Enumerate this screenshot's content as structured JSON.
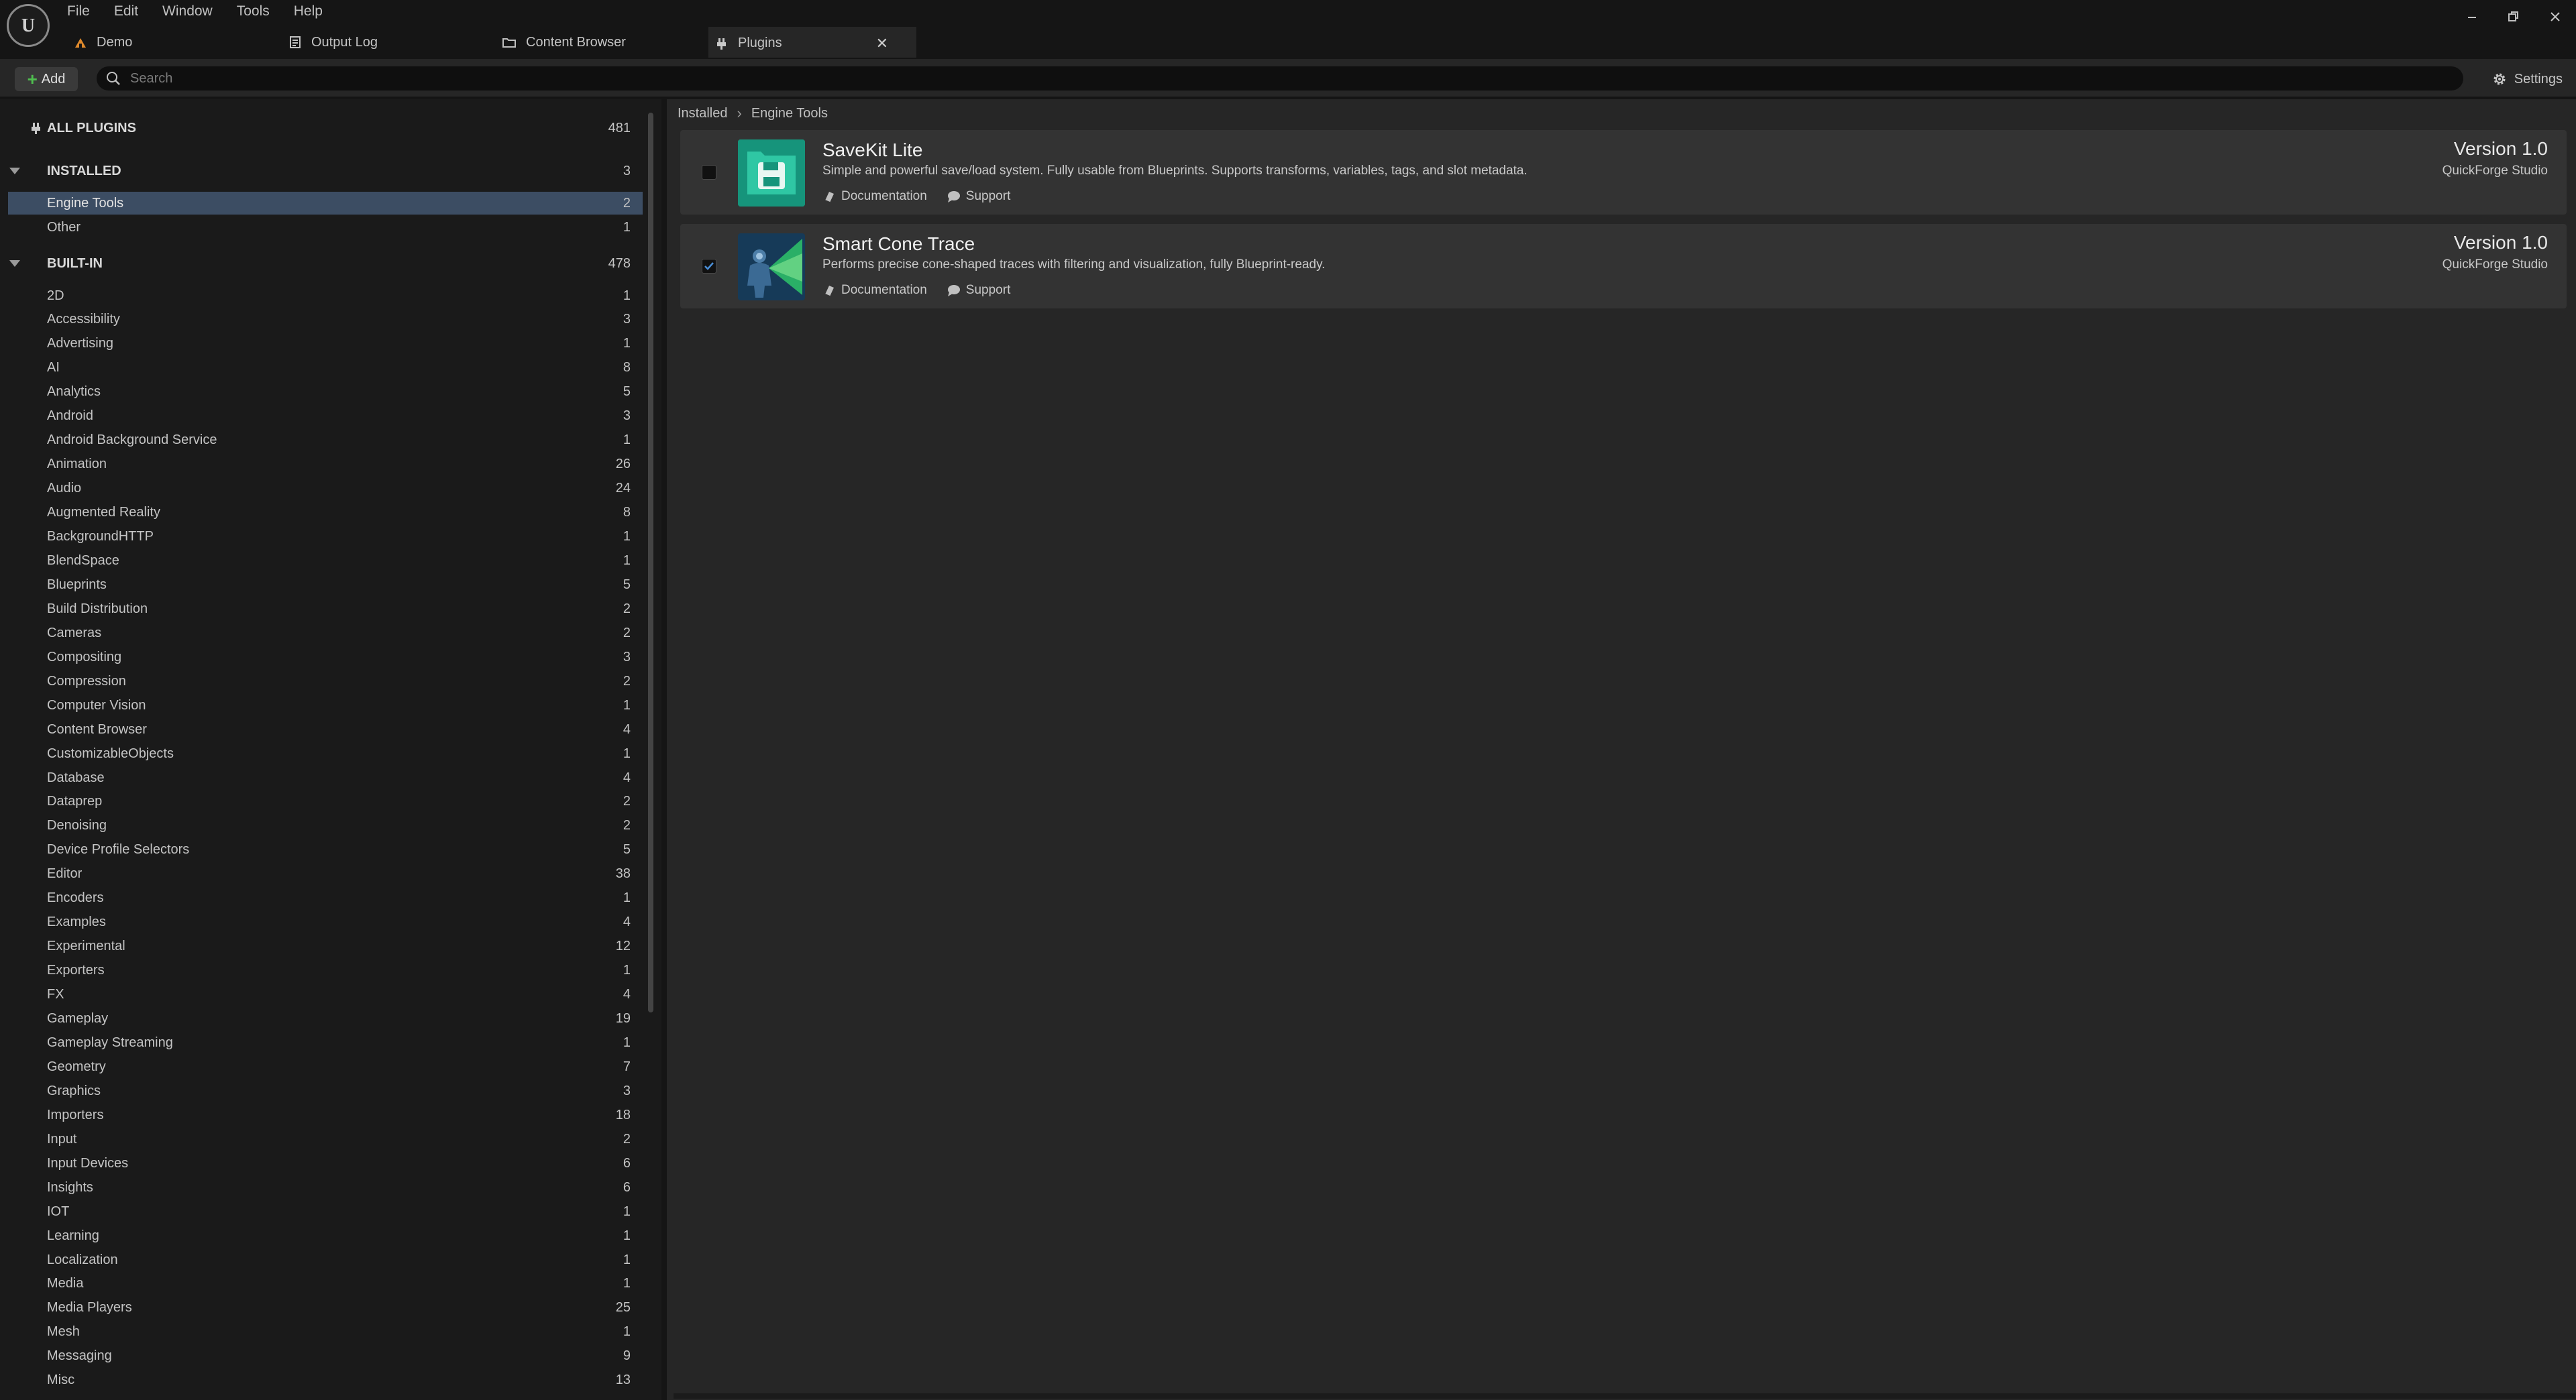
{
  "menu": [
    "File",
    "Edit",
    "Window",
    "Tools",
    "Help"
  ],
  "tabs": [
    {
      "label": "Demo",
      "icon": "level-icon"
    },
    {
      "label": "Output Log",
      "icon": "output-log-icon"
    },
    {
      "label": "Content Browser",
      "icon": "folder-icon"
    },
    {
      "label": "Plugins",
      "icon": "plug-icon",
      "active": true
    }
  ],
  "toolbar": {
    "add_label": "Add",
    "search_placeholder": "Search",
    "settings_label": "Settings"
  },
  "sidebar": {
    "all_plugins": {
      "label": "ALL PLUGINS",
      "count": "481"
    },
    "installed": {
      "label": "INSTALLED",
      "count": "3"
    },
    "installed_items": [
      {
        "label": "Engine Tools",
        "count": "2",
        "selected": true
      },
      {
        "label": "Other",
        "count": "1"
      }
    ],
    "builtin": {
      "label": "BUILT-IN",
      "count": "478"
    },
    "builtin_items": [
      {
        "label": "2D",
        "count": "1"
      },
      {
        "label": "Accessibility",
        "count": "3"
      },
      {
        "label": "Advertising",
        "count": "1"
      },
      {
        "label": "AI",
        "count": "8"
      },
      {
        "label": "Analytics",
        "count": "5"
      },
      {
        "label": "Android",
        "count": "3"
      },
      {
        "label": "Android Background Service",
        "count": "1"
      },
      {
        "label": "Animation",
        "count": "26"
      },
      {
        "label": "Audio",
        "count": "24"
      },
      {
        "label": "Augmented Reality",
        "count": "8"
      },
      {
        "label": "BackgroundHTTP",
        "count": "1"
      },
      {
        "label": "BlendSpace",
        "count": "1"
      },
      {
        "label": "Blueprints",
        "count": "5"
      },
      {
        "label": "Build Distribution",
        "count": "2"
      },
      {
        "label": "Cameras",
        "count": "2"
      },
      {
        "label": "Compositing",
        "count": "3"
      },
      {
        "label": "Compression",
        "count": "2"
      },
      {
        "label": "Computer Vision",
        "count": "1"
      },
      {
        "label": "Content Browser",
        "count": "4"
      },
      {
        "label": "CustomizableObjects",
        "count": "1"
      },
      {
        "label": "Database",
        "count": "4"
      },
      {
        "label": "Dataprep",
        "count": "2"
      },
      {
        "label": "Denoising",
        "count": "2"
      },
      {
        "label": "Device Profile Selectors",
        "count": "5"
      },
      {
        "label": "Editor",
        "count": "38"
      },
      {
        "label": "Encoders",
        "count": "1"
      },
      {
        "label": "Examples",
        "count": "4"
      },
      {
        "label": "Experimental",
        "count": "12"
      },
      {
        "label": "Exporters",
        "count": "1"
      },
      {
        "label": "FX",
        "count": "4"
      },
      {
        "label": "Gameplay",
        "count": "19"
      },
      {
        "label": "Gameplay Streaming",
        "count": "1"
      },
      {
        "label": "Geometry",
        "count": "7"
      },
      {
        "label": "Graphics",
        "count": "3"
      },
      {
        "label": "Importers",
        "count": "18"
      },
      {
        "label": "Input",
        "count": "2"
      },
      {
        "label": "Input Devices",
        "count": "6"
      },
      {
        "label": "Insights",
        "count": "6"
      },
      {
        "label": "IOT",
        "count": "1"
      },
      {
        "label": "Learning",
        "count": "1"
      },
      {
        "label": "Localization",
        "count": "1"
      },
      {
        "label": "Media",
        "count": "1"
      },
      {
        "label": "Media Players",
        "count": "25"
      },
      {
        "label": "Mesh",
        "count": "1"
      },
      {
        "label": "Messaging",
        "count": "9"
      },
      {
        "label": "Misc",
        "count": "13"
      }
    ]
  },
  "breadcrumb": [
    "Installed",
    "Engine Tools"
  ],
  "plugins": [
    {
      "name": "SaveKit Lite",
      "description": "Simple and powerful save/load system. Fully usable from Blueprints. Supports transforms, variables, tags, and slot metadata.",
      "version": "Version 1.0",
      "vendor": "QuickForge Studio",
      "enabled": false,
      "documentation_label": "Documentation",
      "support_label": "Support",
      "icon": "save-disk-icon"
    },
    {
      "name": "Smart Cone Trace",
      "description": "Performs precise cone-shaped traces with filtering and visualization, fully Blueprint-ready.",
      "version": "Version 1.0",
      "vendor": "QuickForge Studio",
      "enabled": true,
      "documentation_label": "Documentation",
      "support_label": "Support",
      "icon": "cone-trace-icon"
    }
  ],
  "colors": {
    "selection": "#3c4d63",
    "card": "#333333",
    "add_plus": "#4fbf4f",
    "savekit_icon": "#1aa488",
    "cone_trace_icon": "#1e4a6e"
  }
}
